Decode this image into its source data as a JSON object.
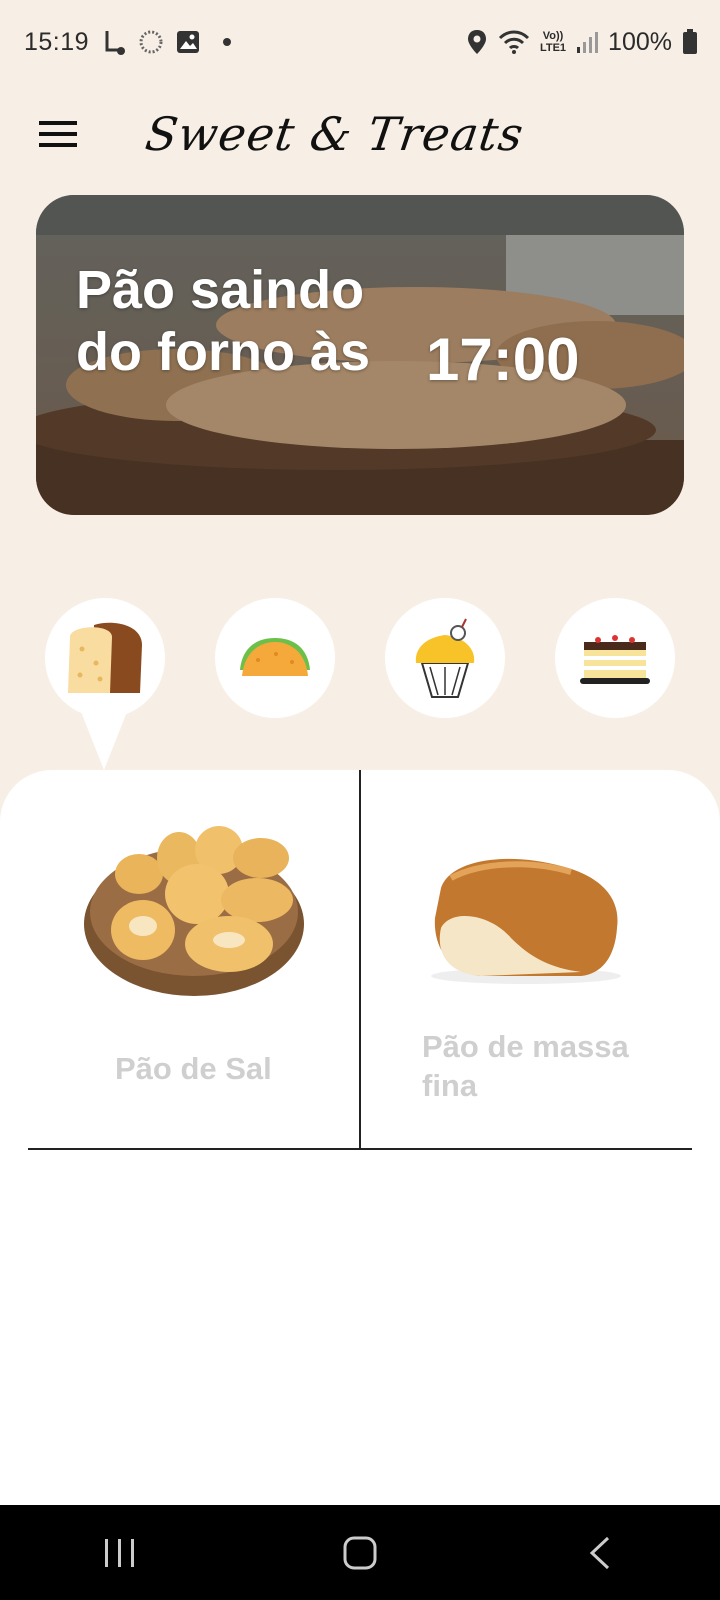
{
  "status_bar": {
    "time": "15:19",
    "battery": "100%",
    "network_label_top": "Vo))",
    "network_label_bottom": "LTE1"
  },
  "app": {
    "logo": "Sweet & Treats"
  },
  "banner": {
    "text": "Pão saindo do forno às",
    "time": "17:00"
  },
  "categories": [
    {
      "name": "bread",
      "icon": "bread-icon",
      "selected": true
    },
    {
      "name": "taco",
      "icon": "taco-icon",
      "selected": false
    },
    {
      "name": "cupcake",
      "icon": "cupcake-icon",
      "selected": false
    },
    {
      "name": "cake",
      "icon": "cake-icon",
      "selected": false
    }
  ],
  "products": [
    {
      "name": "Pão de Sal"
    },
    {
      "name": "Pão de massa fina"
    }
  ],
  "colors": {
    "background": "#f7efe5",
    "panel": "#ffffff",
    "product_label": "#cfcfcf"
  }
}
